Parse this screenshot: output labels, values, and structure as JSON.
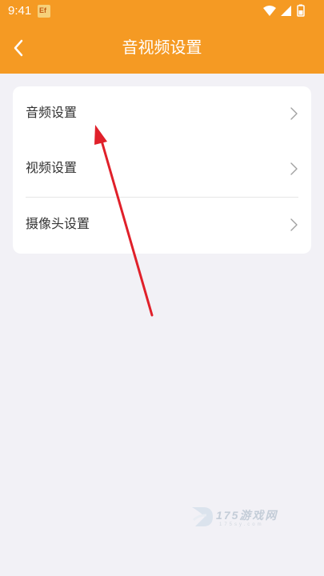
{
  "status_bar": {
    "time": "9:41",
    "app_icon_text": "Ef",
    "icons": [
      "wifi-icon",
      "signal-icon",
      "battery-icon"
    ]
  },
  "header": {
    "title": "音视频设置",
    "back_icon": "chevron-left-icon"
  },
  "menu": {
    "items": [
      {
        "label": "音频设置"
      },
      {
        "label": "视频设置"
      },
      {
        "label": "摄像头设置"
      }
    ]
  },
  "watermark": {
    "text": "175游戏网",
    "sub": "175sy.com"
  },
  "colors": {
    "accent": "#f59a23",
    "background": "#f2f1f6",
    "card": "#ffffff",
    "arrow": "#e0202a"
  }
}
